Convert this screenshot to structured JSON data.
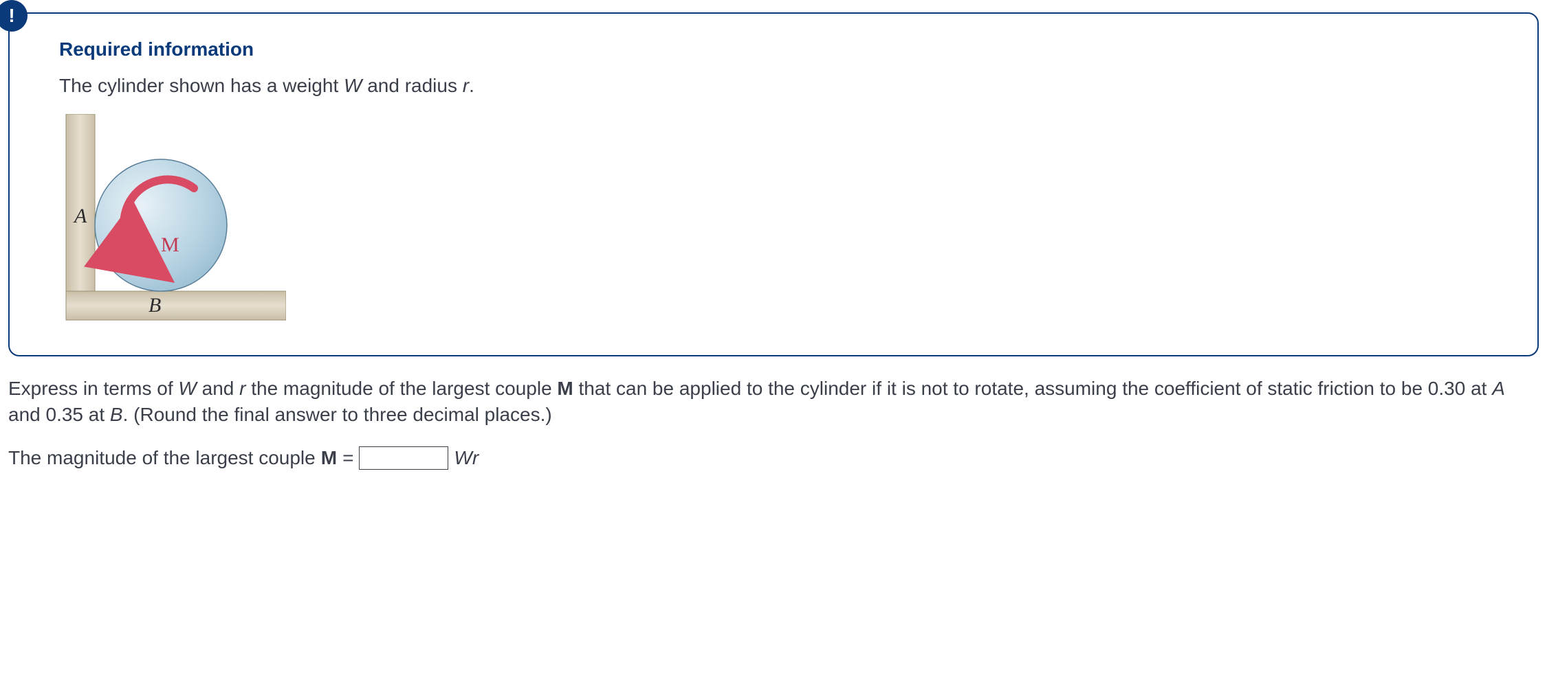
{
  "alert_glyph": "!",
  "heading": "Required information",
  "intro_parts": {
    "p1": "The cylinder shown has a weight ",
    "W": "W",
    "p2": " and radius ",
    "r": "r",
    "p3": "."
  },
  "diagram": {
    "label_A": "A",
    "label_B": "B",
    "label_M": "M"
  },
  "question_parts": {
    "q1": "Express in terms of ",
    "W": "W",
    "q2": " and ",
    "r": "r",
    "q3": " the magnitude of the largest couple ",
    "M": "M",
    "q4": " that can be applied to the cylinder if it is not to rotate, assuming the coefficient of static friction to be 0.30 at ",
    "A": "A",
    "q5": " and 0.35 at ",
    "B": "B",
    "q6": ". (Round the final answer to three decimal places.)"
  },
  "answer_parts": {
    "a1": "The magnitude of the largest couple ",
    "M": "M",
    "a2": " = ",
    "unit": "Wr"
  },
  "input_value": ""
}
